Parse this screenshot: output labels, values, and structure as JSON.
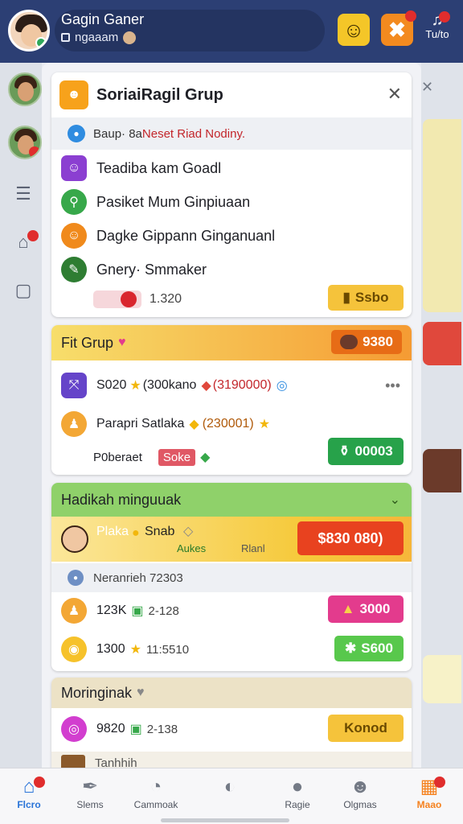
{
  "header": {
    "title": "Gagin Ganer",
    "subtitle": "ngaaam",
    "smile_icon": "smile-face-icon",
    "puzzle_icon": "puzzle-icon",
    "puzzle_badge": "",
    "bell_label": "Tu/to",
    "bell_badge": ""
  },
  "dialog": {
    "title": "SoriaiRagil Grup",
    "close_label": "✕",
    "info_prefix": "Baup· 8a ",
    "info_highlight": "Neset Riad Nodiny.",
    "items": [
      {
        "label": "Teadiba kam Goadl",
        "icon": "profile-icon",
        "color": "#8b3fd1"
      },
      {
        "label": "Pasiket Mum Ginpiuaan",
        "icon": "pin-icon",
        "color": "#37a84a"
      },
      {
        "label": "Dagke Gippann Ginganuanl",
        "icon": "emoji-icon",
        "color": "#f08a1c"
      },
      {
        "label": "Gnery· Smmaker",
        "icon": "pencil-icon",
        "color": "#2e7d32"
      }
    ],
    "footer_value": "1.320",
    "footer_button": "Ssbo"
  },
  "fit_group": {
    "title": "Fit Grup",
    "header_value": "9380",
    "rows": [
      {
        "text": "S020",
        "detail": "(300kano",
        "detail2": "(3190000)"
      },
      {
        "text": "Parapri Satlaka",
        "detail": "(230001)"
      }
    ],
    "footer_label": "P0beraet",
    "footer_tag": "Soke",
    "footer_button": "00003"
  },
  "hadikah": {
    "title": "Hadikah minguuak",
    "promo_name": "Plaka",
    "promo_name2": "Snab",
    "promo_sub": "Aukes",
    "promo_sub2": "Rlanl",
    "promo_button": "$830 080)",
    "info": "Neranrieh  72303",
    "rows": [
      {
        "value": "123K",
        "value2": "2-128",
        "button": "3000"
      },
      {
        "value": "1300",
        "value2": "11:5510",
        "button": "S600"
      }
    ]
  },
  "moringinak": {
    "title": "Moringinak",
    "row_value": "9820",
    "row_value2": "2-138",
    "row_button": "Konod",
    "cut_label": "Tanhhih"
  },
  "nav": [
    {
      "label": "Flcro",
      "icon": "home-icon",
      "active": true
    },
    {
      "label": "Slems",
      "icon": "feather-icon",
      "active": false
    },
    {
      "label": "Cammoak",
      "icon": "chat-bubble-icon",
      "active": false
    },
    {
      "label": "",
      "icon": "timer-icon",
      "active": false
    },
    {
      "label": "Ragie",
      "icon": "person-icon",
      "active": false
    },
    {
      "label": "Olgmas",
      "icon": "chat-emoji-icon",
      "active": false
    },
    {
      "label": "Maao",
      "icon": "menu-grid-icon",
      "active": false
    }
  ],
  "colors": {
    "header_bg": "#2c3f74",
    "accent_yellow": "#f5c518",
    "accent_orange": "#f58220",
    "accent_green": "#28a745",
    "accent_red": "#e8421f",
    "accent_pink": "#e33b8d"
  }
}
